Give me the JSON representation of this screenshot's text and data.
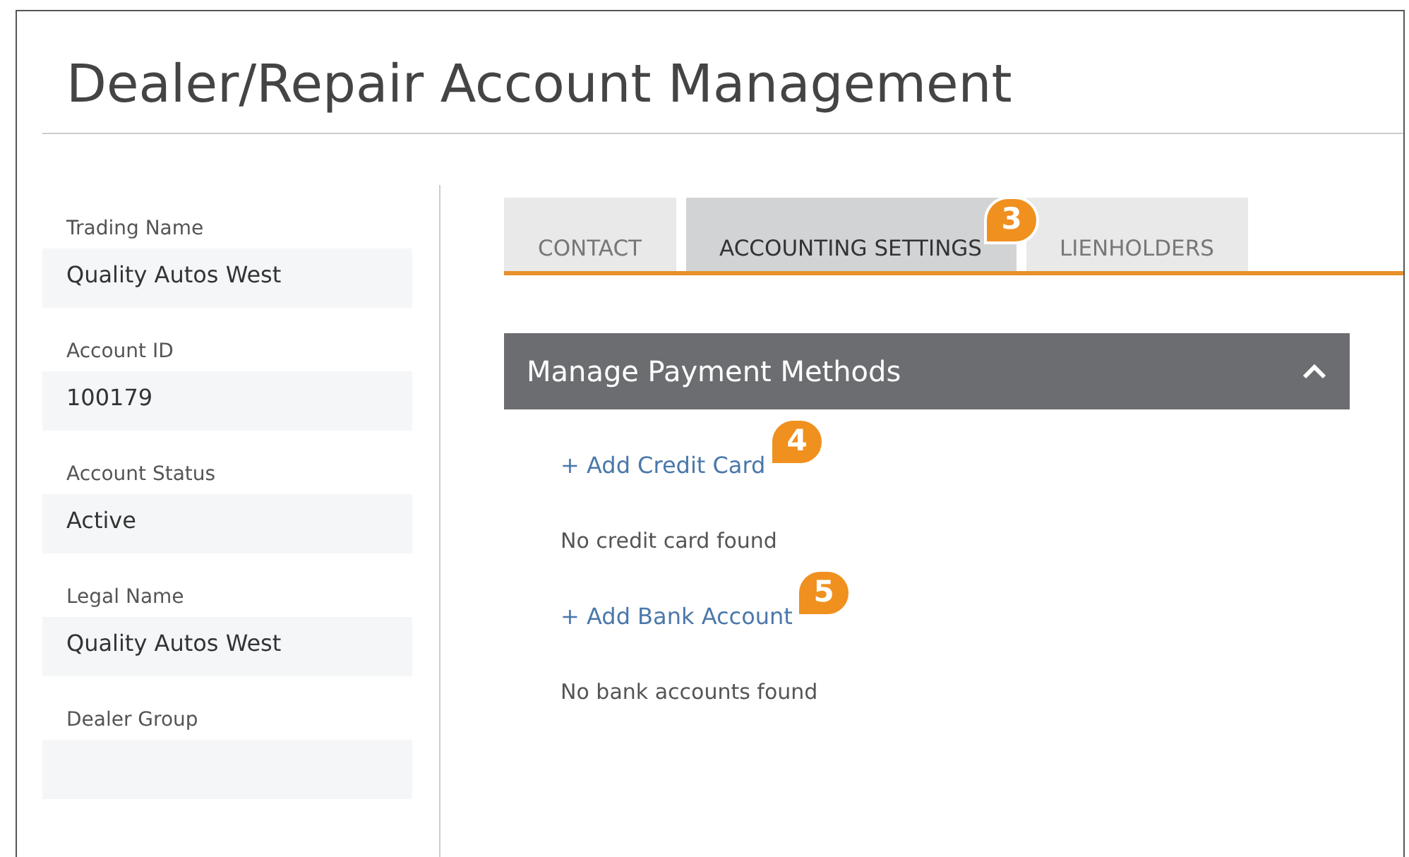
{
  "page": {
    "title": "Dealer/Repair Account Management"
  },
  "fields": [
    {
      "label": "Trading Name",
      "value": "Quality Autos West"
    },
    {
      "label": "Account ID",
      "value": "100179"
    },
    {
      "label": "Account Status",
      "value": "Active"
    },
    {
      "label": "Legal Name",
      "value": "Quality Autos West"
    },
    {
      "label": "Dealer Group"
    }
  ],
  "tabs": [
    {
      "label": "CONTACT",
      "selected": false
    },
    {
      "label": "ACCOUNTING SETTINGS",
      "selected": true,
      "callout": "3"
    },
    {
      "label": "LIENHOLDERS",
      "selected": false
    }
  ],
  "panel": {
    "title": "Manage Payment Methods",
    "expanded": true,
    "items": [
      {
        "kind": "link",
        "text": "+ Add Credit Card",
        "callout": "4"
      },
      {
        "kind": "text",
        "text": "No credit card found"
      },
      {
        "kind": "link",
        "text": "+ Add Bank Account",
        "callout": "5"
      },
      {
        "kind": "text",
        "text": "No bank accounts found"
      }
    ]
  }
}
